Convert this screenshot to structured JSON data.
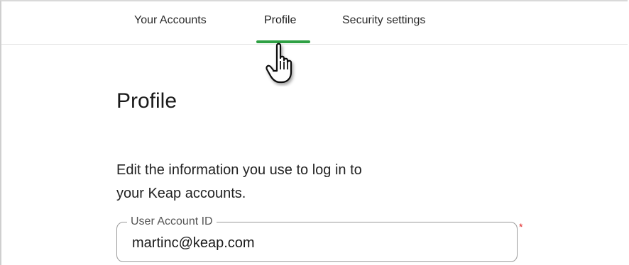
{
  "nav": {
    "tabs": [
      {
        "label": "Your Accounts"
      },
      {
        "label": "Profile"
      },
      {
        "label": "Security settings"
      }
    ],
    "active_tab": "Profile",
    "accent_color": "#2ea043"
  },
  "main": {
    "title": "Profile",
    "description_line1": "Edit the information you use to log in to",
    "description_line2": "your Keap accounts.",
    "user_field": {
      "label": "User Account ID",
      "value": "martinc@keap.com",
      "required_marker": "*",
      "required_color": "#e02020"
    }
  },
  "icons": {
    "cursor": "hand-pointer-icon"
  }
}
